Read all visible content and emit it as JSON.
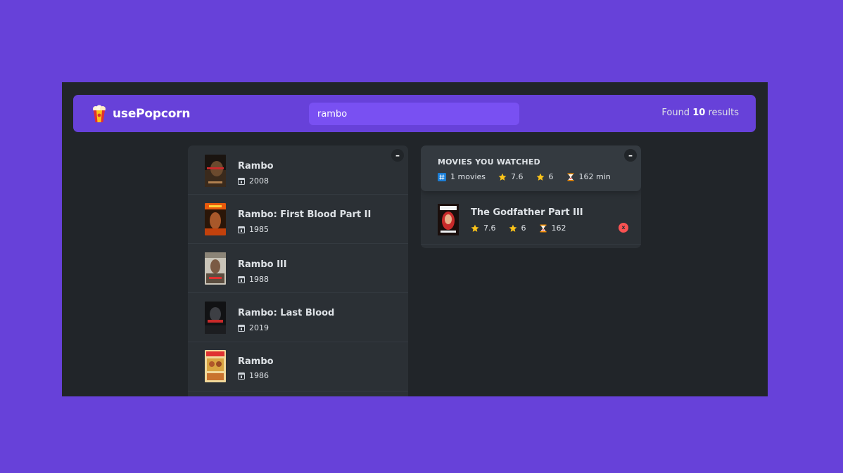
{
  "nav": {
    "logo_text": "usePopcorn",
    "search_value": "rambo",
    "results_prefix": "Found",
    "results_count": "10",
    "results_suffix": "results"
  },
  "search_results": {
    "toggle_label": "–",
    "movies": [
      {
        "title": "Rambo",
        "year": "2008",
        "poster_icon": "rambo-2008-poster"
      },
      {
        "title": "Rambo: First Blood Part II",
        "year": "1985",
        "poster_icon": "rambo-first-blood-2-poster"
      },
      {
        "title": "Rambo III",
        "year": "1988",
        "poster_icon": "rambo-3-poster"
      },
      {
        "title": "Rambo: Last Blood",
        "year": "2019",
        "poster_icon": "rambo-last-blood-poster"
      },
      {
        "title": "Rambo",
        "year": "1986",
        "poster_icon": "rambo-1986-poster"
      }
    ]
  },
  "watched": {
    "toggle_label": "–",
    "summary_title": "MOVIES YOU WATCHED",
    "num_movies": "1 movies",
    "avg_imdb": "7.6",
    "avg_user": "6",
    "avg_runtime": "162 min",
    "movies": [
      {
        "title": "The Godfather Part III",
        "imdb": "7.6",
        "user": "6",
        "runtime": "162",
        "delete_label": "x"
      }
    ]
  },
  "colors": {
    "page_bg": "#6741d9",
    "app_bg": "#212529",
    "box_bg": "#2b3035",
    "summary_bg": "#343a40",
    "search_bg": "#7950f2",
    "delete_red": "#fa5252",
    "star_gold": "#fcc419"
  }
}
